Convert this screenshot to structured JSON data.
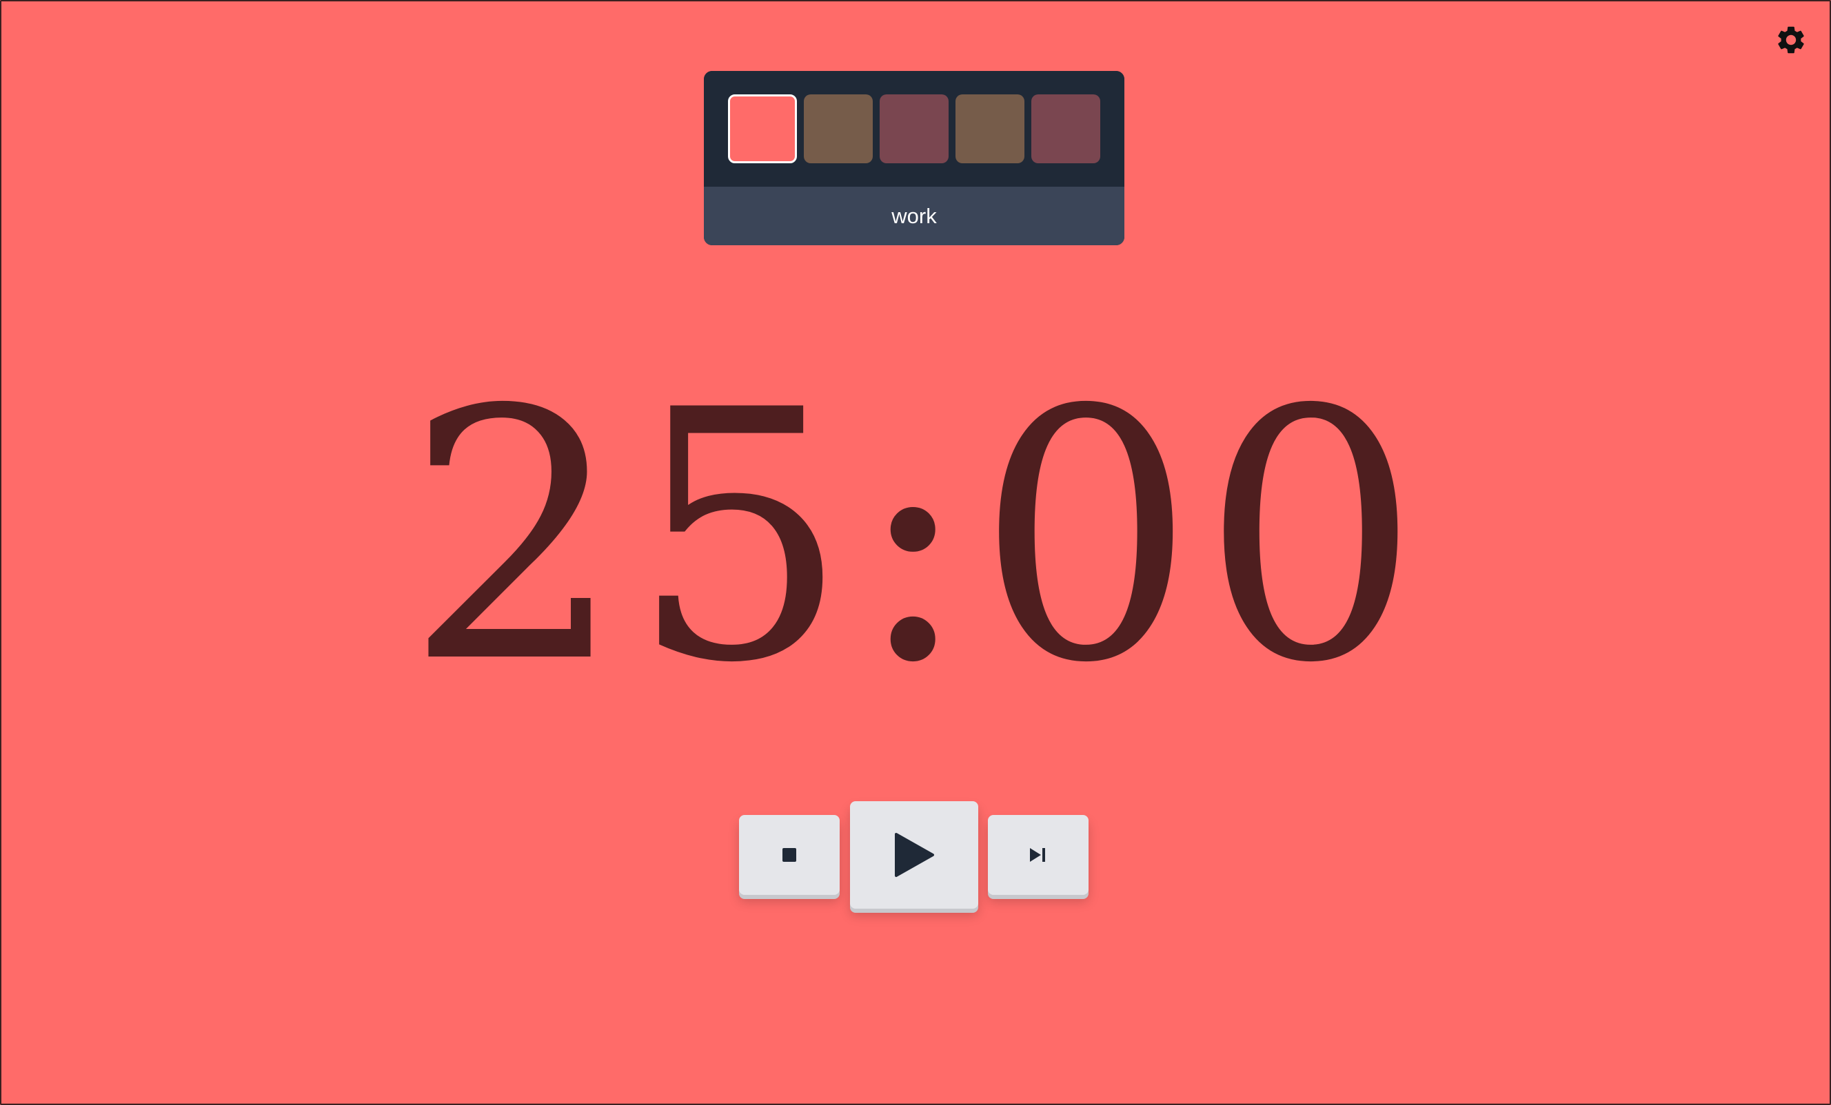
{
  "app": {
    "background_color": "#ff6b69"
  },
  "settings": {
    "icon": "gear-icon"
  },
  "session_selector": {
    "swatches": [
      {
        "color": "#ff6b69",
        "selected": true
      },
      {
        "color": "#765c4a",
        "selected": false
      },
      {
        "color": "#7a4650",
        "selected": false
      },
      {
        "color": "#765c4a",
        "selected": false
      },
      {
        "color": "#7a4650",
        "selected": false
      }
    ],
    "label": "work"
  },
  "timer": {
    "display": "25:00",
    "color": "#4e1e1f"
  },
  "controls": {
    "stop_icon": "stop-icon",
    "play_icon": "play-icon",
    "skip_icon": "skip-next-icon"
  }
}
